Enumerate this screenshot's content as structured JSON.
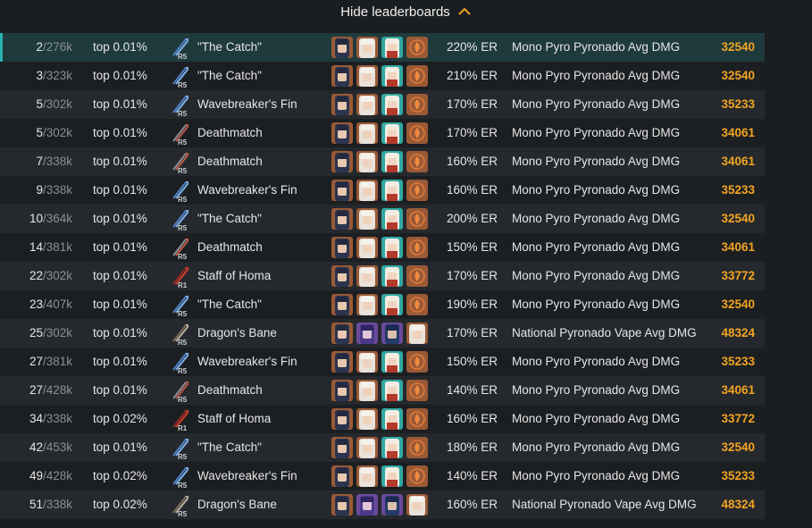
{
  "toggle": {
    "label": "Hide leaderboards",
    "icon": "chevron-up-icon"
  },
  "colors": {
    "accent": "#f2a422",
    "highlight": "#1f3a3c",
    "highlight_edge": "#2bb3b0"
  },
  "rows": [
    {
      "rank": "2",
      "total": "/276k",
      "pct": "top 0.01%",
      "weapon": "\"The Catch\"",
      "refine": "R5",
      "wtype": "polearm-blue",
      "party": "mono",
      "er": "220% ER",
      "calc": "Mono Pyro Pyronado Avg DMG",
      "value": "32540"
    },
    {
      "rank": "3",
      "total": "/323k",
      "pct": "top 0.01%",
      "weapon": "\"The Catch\"",
      "refine": "R5",
      "wtype": "polearm-blue",
      "party": "mono",
      "er": "210% ER",
      "calc": "Mono Pyro Pyronado Avg DMG",
      "value": "32540"
    },
    {
      "rank": "5",
      "total": "/302k",
      "pct": "top 0.01%",
      "weapon": "Wavebreaker's Fin",
      "refine": "R5",
      "wtype": "polearm-blue",
      "party": "mono",
      "er": "170% ER",
      "calc": "Mono Pyro Pyronado Avg DMG",
      "value": "35233"
    },
    {
      "rank": "5",
      "total": "/302k",
      "pct": "top 0.01%",
      "weapon": "Deathmatch",
      "refine": "R5",
      "wtype": "polearm-red",
      "party": "mono",
      "er": "170% ER",
      "calc": "Mono Pyro Pyronado Avg DMG",
      "value": "34061"
    },
    {
      "rank": "7",
      "total": "/338k",
      "pct": "top 0.01%",
      "weapon": "Deathmatch",
      "refine": "R5",
      "wtype": "polearm-red",
      "party": "mono",
      "er": "160% ER",
      "calc": "Mono Pyro Pyronado Avg DMG",
      "value": "34061"
    },
    {
      "rank": "9",
      "total": "/338k",
      "pct": "top 0.01%",
      "weapon": "Wavebreaker's Fin",
      "refine": "R5",
      "wtype": "polearm-blue",
      "party": "mono",
      "er": "160% ER",
      "calc": "Mono Pyro Pyronado Avg DMG",
      "value": "35233"
    },
    {
      "rank": "10",
      "total": "/364k",
      "pct": "top 0.01%",
      "weapon": "\"The Catch\"",
      "refine": "R5",
      "wtype": "polearm-blue",
      "party": "mono",
      "er": "200% ER",
      "calc": "Mono Pyro Pyronado Avg DMG",
      "value": "32540"
    },
    {
      "rank": "14",
      "total": "/381k",
      "pct": "top 0.01%",
      "weapon": "Deathmatch",
      "refine": "R5",
      "wtype": "polearm-red",
      "party": "mono",
      "er": "150% ER",
      "calc": "Mono Pyro Pyronado Avg DMG",
      "value": "34061"
    },
    {
      "rank": "22",
      "total": "/302k",
      "pct": "top 0.01%",
      "weapon": "Staff of Homa",
      "refine": "R1",
      "wtype": "polearm-crimson",
      "party": "mono",
      "er": "170% ER",
      "calc": "Mono Pyro Pyronado Avg DMG",
      "value": "33772"
    },
    {
      "rank": "23",
      "total": "/407k",
      "pct": "top 0.01%",
      "weapon": "\"The Catch\"",
      "refine": "R5",
      "wtype": "polearm-blue",
      "party": "mono",
      "er": "190% ER",
      "calc": "Mono Pyro Pyronado Avg DMG",
      "value": "32540"
    },
    {
      "rank": "25",
      "total": "/302k",
      "pct": "top 0.01%",
      "weapon": "Dragon's Bane",
      "refine": "R5",
      "wtype": "polearm-grey",
      "party": "national",
      "er": "170% ER",
      "calc": "National Pyronado Vape Avg DMG",
      "value": "48324"
    },
    {
      "rank": "27",
      "total": "/381k",
      "pct": "top 0.01%",
      "weapon": "Wavebreaker's Fin",
      "refine": "R5",
      "wtype": "polearm-blue",
      "party": "mono",
      "er": "150% ER",
      "calc": "Mono Pyro Pyronado Avg DMG",
      "value": "35233"
    },
    {
      "rank": "27",
      "total": "/428k",
      "pct": "top 0.01%",
      "weapon": "Deathmatch",
      "refine": "R5",
      "wtype": "polearm-red",
      "party": "mono",
      "er": "140% ER",
      "calc": "Mono Pyro Pyronado Avg DMG",
      "value": "34061"
    },
    {
      "rank": "34",
      "total": "/338k",
      "pct": "top 0.02%",
      "weapon": "Staff of Homa",
      "refine": "R1",
      "wtype": "polearm-crimson",
      "party": "mono",
      "er": "160% ER",
      "calc": "Mono Pyro Pyronado Avg DMG",
      "value": "33772"
    },
    {
      "rank": "42",
      "total": "/453k",
      "pct": "top 0.01%",
      "weapon": "\"The Catch\"",
      "refine": "R5",
      "wtype": "polearm-blue",
      "party": "mono",
      "er": "180% ER",
      "calc": "Mono Pyro Pyronado Avg DMG",
      "value": "32540"
    },
    {
      "rank": "49",
      "total": "/428k",
      "pct": "top 0.02%",
      "weapon": "Wavebreaker's Fin",
      "refine": "R5",
      "wtype": "polearm-blue",
      "party": "mono",
      "er": "140% ER",
      "calc": "Mono Pyro Pyronado Avg DMG",
      "value": "35233"
    },
    {
      "rank": "51",
      "total": "/338k",
      "pct": "top 0.02%",
      "weapon": "Dragon's Bane",
      "refine": "R5",
      "wtype": "polearm-grey",
      "party": "national",
      "er": "160% ER",
      "calc": "National Pyronado Vape Avg DMG",
      "value": "48324"
    }
  ]
}
